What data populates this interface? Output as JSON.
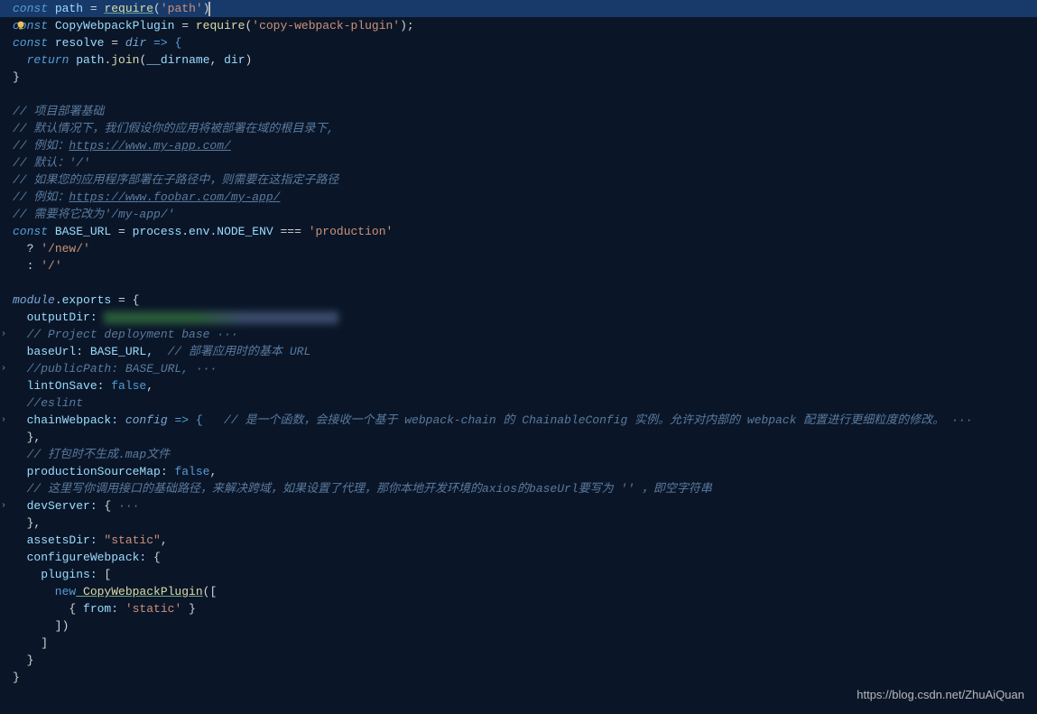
{
  "code": {
    "l1_const": "const",
    "l1_path": " path ",
    "l1_eq": "= ",
    "l1_require": "require",
    "l1_popen": "(",
    "l1_str": "'path'",
    "l1_pclose": ")",
    "l2_const": "const",
    "l2_var": " CopyWebpackPlugin ",
    "l2_eq": "= ",
    "l2_require": "require",
    "l2_arg": "('copy-webpack-plugin');",
    "l2_str": "'copy-webpack-plugin'",
    "l3_const": "const",
    "l3_var": " resolve ",
    "l3_eq": "= ",
    "l3_param": "dir",
    "l3_arrow": " => {",
    "l4_return": "  return",
    "l4_path": " path",
    "l4_join": ".join",
    "l4_args": "(__dirname, dir)",
    "l4_dirname": "__dirname",
    "l4_dir": "dir",
    "l5": "}",
    "c1": "// 项目部署基础",
    "c2": "// 默认情况下，我们假设你的应用将被部署在域的根目录下,",
    "c3_pre": "// 例如：",
    "c3_link": "https://www.my-app.com/",
    "c4": "// 默认：'/'",
    "c5": "// 如果您的应用程序部署在子路径中，则需要在这指定子路径",
    "c6_pre": "// 例如：",
    "c6_link": "https://www.foobar.com/my-app/",
    "c7": "// 需要将它改为'/my-app/'",
    "l14_const": "const",
    "l14_var": " BASE_URL ",
    "l14_eq": "= ",
    "l14_process": "process",
    "l14_env": ".env",
    "l14_node": ".NODE_ENV ",
    "l14_eqeq": "=== ",
    "l14_str": "'production'",
    "l15_q": "  ? ",
    "l15_str": "'/new/'",
    "l16_c": "  : ",
    "l16_str": "'/'",
    "l18_module": "module",
    "l18_exports": ".exports",
    "l18_eq": " = {",
    "l19_prop": "  outputDir:",
    "l19_blur": " ",
    "c8": "  // Project deployment base",
    "c8_dots": " ···",
    "l21_prop": "  baseUrl:",
    "l21_val": " BASE_URL,",
    "l21_cmt": "  // 部署应用时的基本 URL",
    "c9": "  //publicPath: BASE_URL,",
    "c9_dots": " ···",
    "l23_prop": "  lintOnSave:",
    "l23_val": " false",
    "l23_comma": ",",
    "c10": "  //eslint",
    "l25_prop": "  chainWebpack:",
    "l25_param": " config",
    "l25_arrow": " => { ",
    "l25_cmt": "  // 是一个函数，会接收一个基于 webpack-chain 的 ChainableConfig 实例。允许对内部的 webpack 配置进行更细粒度的修改。",
    "l25_dots": " ···",
    "l26": "  },",
    "c11": "  // 打包时不生成.map文件",
    "l28_prop": "  productionSourceMap:",
    "l28_val": " false",
    "l28_comma": ",",
    "c12": "  // 这里写你调用接口的基础路径，来解决跨域，如果设置了代理，那你本地开发环境的axios的baseUrl要写为 '' ，即空字符串",
    "l30_prop": "  devServer:",
    "l30_brace": " {",
    "l30_dots": " ···",
    "l31": "  },",
    "l32_prop": "  assetsDir:",
    "l32_val": " \"static\"",
    "l32_comma": ",",
    "l33_prop": "  configureWebpack:",
    "l33_brace": " {",
    "l34_prop": "    plugins:",
    "l34_bracket": " [",
    "l35_new": "      new",
    "l35_class": " CopyWebpackPlugin",
    "l35_open": "([",
    "l36_brace": "        { ",
    "l36_prop": "from:",
    "l36_val": " 'static'",
    "l36_close": " }",
    "l37": "      ])",
    "l38": "    ]",
    "l39": "  }",
    "l40": "}"
  },
  "watermark": "https://blog.csdn.net/ZhuAiQuan"
}
